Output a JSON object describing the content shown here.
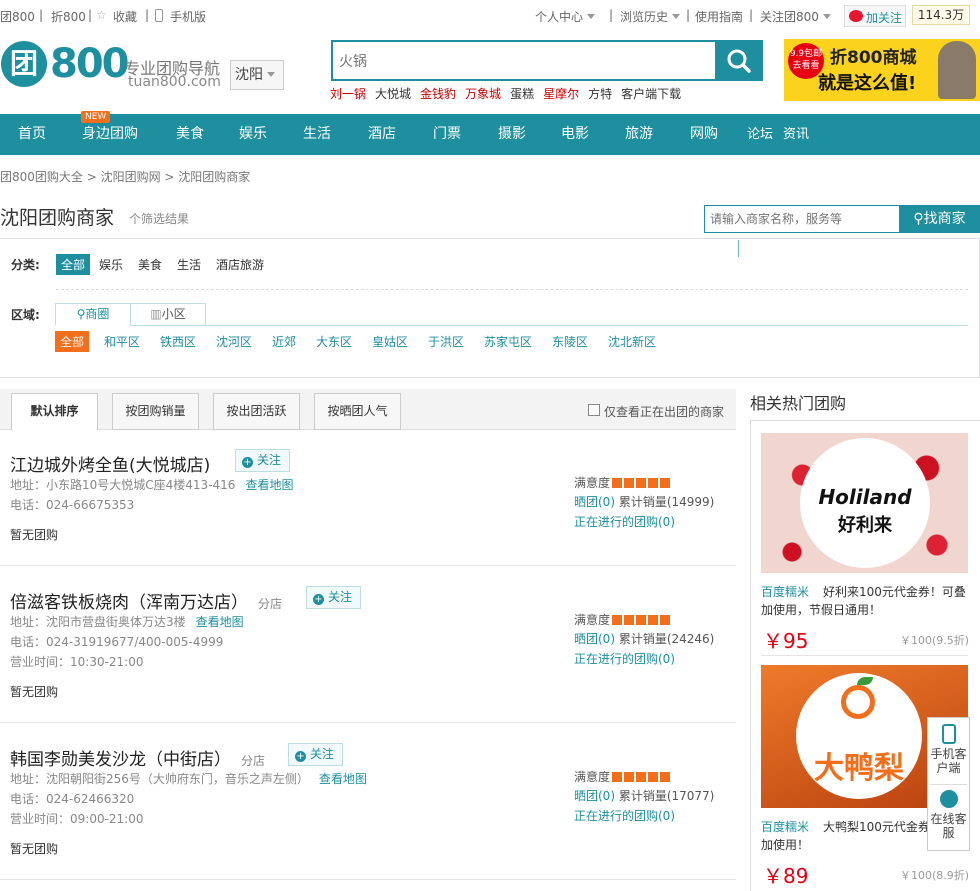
{
  "topbar": {
    "site": "团800",
    "discount": "折800",
    "favorite": "收藏",
    "mobile": "手机版",
    "user_center": "个人中心",
    "history": "浏览历史",
    "guide": "使用指南",
    "follow_site": "关注团800",
    "weibo_follow": "加关注",
    "followers": "114.3万"
  },
  "header": {
    "logo_mark": "团",
    "logo_text": "800",
    "slogan": "专业团购导航",
    "domain": "tuan800.com",
    "city": "沈阳",
    "search_value": "火锅",
    "hotwords": [
      "刘一锅",
      "大悦城",
      "金钱豹",
      "万象城",
      "蛋糕",
      "星摩尔",
      "方特",
      "客户端下载"
    ],
    "hotword_colors": [
      "#cc0000",
      "#333333",
      "#cc0000",
      "#cc0000",
      "#333333",
      "#cc0000",
      "#333333",
      "#333333"
    ],
    "banner": {
      "badge_top": "9.9包邮",
      "badge_bottom": "去看看",
      "title": "折800商城",
      "subtitle": "就是这么值!"
    }
  },
  "nav": {
    "new_badge": "NEW",
    "items": [
      "首页",
      "身边团购",
      "美食",
      "娱乐",
      "生活",
      "酒店",
      "门票",
      "摄影",
      "电影",
      "旅游",
      "网购",
      "论坛",
      "资讯"
    ]
  },
  "breadcrumb": "团800团购大全 > 沈阳团购网 > 沈阳团购商家",
  "page": {
    "title": "沈阳团购商家",
    "result_count": "个筛选结果",
    "search_placeholder": "请输入商家名称，服务等",
    "search_button": "找商家"
  },
  "filter": {
    "category_label": "分类:",
    "categories": [
      "全部",
      "娱乐",
      "美食",
      "生活",
      "酒店旅游"
    ],
    "area_label": "区域:",
    "area_tabs": [
      "商圈",
      "小区"
    ],
    "districts": [
      "全部",
      "和平区",
      "铁西区",
      "沈河区",
      "近郊",
      "大东区",
      "皇姑区",
      "于洪区",
      "苏家屯区",
      "东陵区",
      "沈北新区"
    ]
  },
  "sort_tabs": [
    "默认排序",
    "按团购销量",
    "按出团活跃",
    "按晒团人气"
  ],
  "only_active_label": "仅查看正在出团的商家",
  "follow_label": "关注",
  "merchants": [
    {
      "name": "江边城外烤全鱼(大悦城店)",
      "branch": "",
      "address": "地址：小东路10号大悦城C座4楼413-416",
      "map": "查看地图",
      "phone": "电话：024-66675353",
      "hours": "",
      "status": "暂无团购",
      "rating_label": "满意度",
      "reviews": "晒团(0)",
      "sales": "累计销量(14999)",
      "ongoing": "正在进行的团购(0)"
    },
    {
      "name": "倍滋客铁板烧肉（浑南万达店）",
      "branch": "分店",
      "address": "地址：沈阳市营盘街奥体万达3楼",
      "map": "查看地图",
      "phone": "电话：024-31919677/400-005-4999",
      "hours": "营业时间：10:30-21:00",
      "status": "暂无团购",
      "rating_label": "满意度",
      "reviews": "晒团(0)",
      "sales": "累计销量(24246)",
      "ongoing": "正在进行的团购(0)"
    },
    {
      "name": "韩国李勋美发沙龙（中街店）",
      "branch": "分店",
      "address": "地址：沈阳朝阳街256号（大帅府东门，音乐之声左侧）",
      "map": "查看地图",
      "phone": "电话：024-62466320",
      "hours": "营业时间：09:00-21:00",
      "status": "暂无团购",
      "rating_label": "满意度",
      "reviews": "晒团(0)",
      "sales": "累计销量(17077)",
      "ongoing": "正在进行的团购(0)"
    }
  ],
  "sidebar": {
    "title": "相关热门团购",
    "deals": [
      {
        "logo_en": "Holiland",
        "logo_cn": "好利来",
        "source": "百度糯米",
        "desc": "好利来100元代金券！可叠加使用，节假日通用！",
        "price": "￥95",
        "original": "￥100(9.5折)"
      },
      {
        "logo_cn": "大鸭梨",
        "source": "百度糯米",
        "desc": "大鸭梨100元代金券！可叠加使用！",
        "price": "￥89",
        "original": "￥100(8.9折)"
      }
    ]
  },
  "float_service": {
    "app": "手机客户端",
    "support": "在线客服"
  },
  "colors": {
    "brand": "#1d8f9e",
    "accent": "#f36e1b",
    "price": "#e60012",
    "hot": "#cc0000"
  }
}
